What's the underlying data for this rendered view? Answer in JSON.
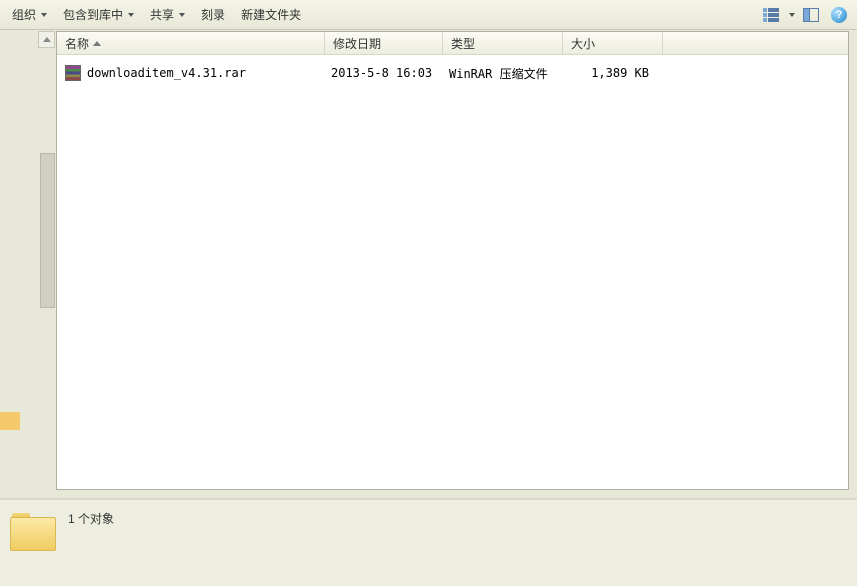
{
  "toolbar": {
    "organize": "组织",
    "include_in_library": "包含到库中",
    "share": "共享",
    "burn": "刻录",
    "new_folder": "新建文件夹"
  },
  "columns": {
    "name": "名称",
    "date": "修改日期",
    "type": "类型",
    "size": "大小"
  },
  "files": [
    {
      "name": "downloaditem_v4.31.rar",
      "date": "2013-5-8 16:03",
      "type": "WinRAR 压缩文件",
      "size": "1,389 KB"
    }
  ],
  "status": {
    "object_count": "1 个对象"
  },
  "help_glyph": "?"
}
